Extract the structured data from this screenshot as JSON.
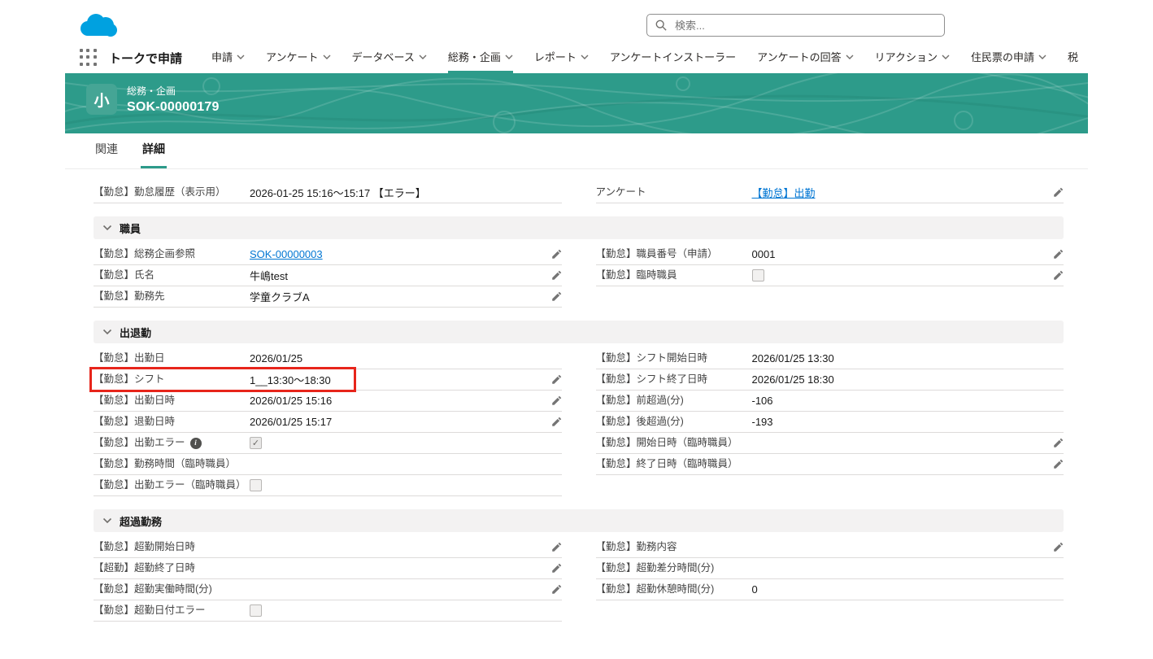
{
  "header": {
    "search_placeholder": "検索...",
    "app_name": "トークで申請",
    "nav_tabs": [
      {
        "label": "申請",
        "caret": true,
        "active": false
      },
      {
        "label": "アンケート",
        "caret": true,
        "active": false
      },
      {
        "label": "データベース",
        "caret": true,
        "active": false
      },
      {
        "label": "総務・企画",
        "caret": true,
        "active": true
      },
      {
        "label": "レポート",
        "caret": true,
        "active": false
      },
      {
        "label": "アンケートインストーラー",
        "caret": false,
        "active": false
      },
      {
        "label": "アンケートの回答",
        "caret": true,
        "active": false
      },
      {
        "label": "リアクション",
        "caret": true,
        "active": false
      },
      {
        "label": "住民票の申請",
        "caret": true,
        "active": false
      },
      {
        "label": "税",
        "caret": false,
        "active": false
      }
    ]
  },
  "record_banner": {
    "entity": "総務・企画",
    "record_name": "SOK-00000179",
    "icon_glyph": "小"
  },
  "subtabs": [
    {
      "label": "関連",
      "active": false
    },
    {
      "label": "詳細",
      "active": true
    }
  ],
  "detail": {
    "top": {
      "left": [
        {
          "label": "【勤怠】勤怠履歴（表示用）",
          "value": "2026-01-25 15:16～15:17 【エラー】"
        }
      ],
      "right": [
        {
          "label": "アンケート",
          "value": "【勤怠】出勤",
          "link": true,
          "editable": true
        }
      ]
    },
    "sections": [
      {
        "title": "職員",
        "left": [
          {
            "label": "【勤怠】総務企画参照",
            "value": "SOK-00000003",
            "link": true,
            "editable": true
          },
          {
            "label": "【勤怠】氏名",
            "value": "牛嶋test",
            "editable": true
          },
          {
            "label": "【勤怠】勤務先",
            "value": "学童クラブA",
            "editable": true
          }
        ],
        "right": [
          {
            "label": "【勤怠】職員番号（申請）",
            "value": "0001",
            "editable": true
          },
          {
            "label": "【勤怠】臨時職員",
            "checkbox": "unchecked",
            "editable": true
          }
        ]
      },
      {
        "title": "出退勤",
        "left": [
          {
            "label": "【勤怠】出勤日",
            "value": "2026/01/25"
          },
          {
            "label": "【勤怠】シフト",
            "value": "1__13:30～18:30",
            "editable": true,
            "highlight": true
          },
          {
            "label": "【勤怠】出勤日時",
            "value": "2026/01/25 15:16",
            "editable": true
          },
          {
            "label": "【勤怠】退勤日時",
            "value": "2026/01/25 15:17",
            "editable": true
          },
          {
            "label": "【勤怠】出勤エラー",
            "info": true,
            "checkbox": "checked"
          },
          {
            "label": "【勤怠】勤務時間（臨時職員）"
          },
          {
            "label": "【勤怠】出勤エラー（臨時職員）",
            "checkbox": "unchecked"
          }
        ],
        "right": [
          {
            "label": "【勤怠】シフト開始日時",
            "value": "2026/01/25 13:30"
          },
          {
            "label": "【勤怠】シフト終了日時",
            "value": "2026/01/25 18:30"
          },
          {
            "label": "【勤怠】前超過(分)",
            "value": "-106"
          },
          {
            "label": "【勤怠】後超過(分)",
            "value": "-193"
          },
          {
            "label": "【勤怠】開始日時（臨時職員）",
            "editable": true
          },
          {
            "label": "【勤怠】終了日時（臨時職員）",
            "editable": true
          }
        ]
      },
      {
        "title": "超過勤務",
        "left": [
          {
            "label": "【勤怠】超勤開始日時",
            "editable": true
          },
          {
            "label": "【超勤】超勤終了日時",
            "editable": true
          },
          {
            "label": "【勤怠】超勤実働時間(分)",
            "editable": true
          },
          {
            "label": "【勤怠】超勤日付エラー",
            "checkbox": "unchecked"
          }
        ],
        "right": [
          {
            "label": "【勤怠】勤務内容",
            "editable": true
          },
          {
            "label": "【勤怠】超勤差分時間(分)"
          },
          {
            "label": "【勤怠】超勤休憩時間(分)",
            "value": "0"
          }
        ]
      }
    ]
  },
  "colors": {
    "brand_teal": "#2D9B8A",
    "link_blue": "#0176d3",
    "highlight_red": "#E7251B",
    "logo_blue": "#00A1E0"
  }
}
